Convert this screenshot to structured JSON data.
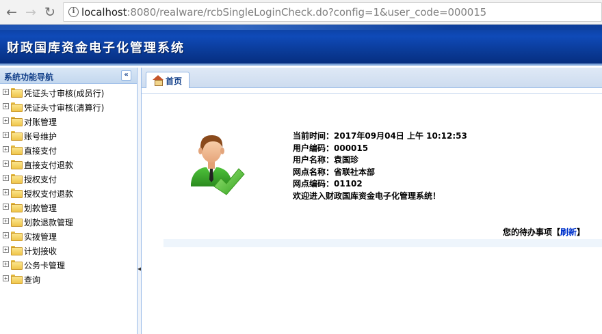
{
  "browser": {
    "url_host": "localhost",
    "url_rest": ":8080/realware/rcbSingleLoginCheck.do?config=1&user_code=000015"
  },
  "app": {
    "title": "财政国库资金电子化管理系统"
  },
  "sidebar": {
    "title": "系统功能导航",
    "items": [
      {
        "label": "凭证头寸审核(成员行)"
      },
      {
        "label": "凭证头寸审核(清算行)"
      },
      {
        "label": "对账管理"
      },
      {
        "label": "账号维护"
      },
      {
        "label": "直接支付"
      },
      {
        "label": "直接支付退款"
      },
      {
        "label": "授权支付"
      },
      {
        "label": "授权支付退款"
      },
      {
        "label": "划款管理"
      },
      {
        "label": "划款退款管理"
      },
      {
        "label": "实拨管理"
      },
      {
        "label": "计划接收"
      },
      {
        "label": "公务卡管理"
      },
      {
        "label": "查询"
      }
    ]
  },
  "tabs": [
    {
      "label": "首页"
    }
  ],
  "user_info": {
    "time_line": "当前时间：2017年09月04日 上午 10:12:53",
    "code_line": "用户编码：000015",
    "name_line": "用户名称：袁国珍",
    "branch_name_line": "网点名称：省联社本部",
    "branch_code_line": "网点编码：01102",
    "welcome_line": "欢迎进入财政国库资金电子化管理系统！"
  },
  "todo": {
    "label": "您的待办事项",
    "bracket_open": "【",
    "refresh_label": "刷新",
    "bracket_close": "】"
  },
  "colors": {
    "header": "#0a3a96",
    "accent_border": "#99bbe8",
    "link": "#0033cc"
  }
}
